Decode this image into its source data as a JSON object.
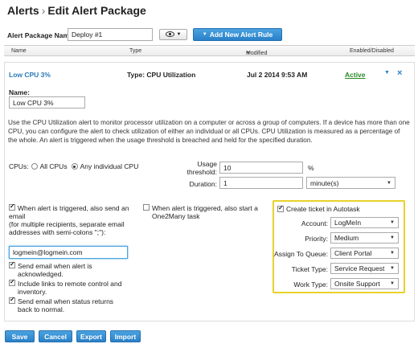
{
  "header": {
    "crumb": "Alerts",
    "separator": "›",
    "title": "Edit Alert Package"
  },
  "package": {
    "name_label": "Alert Package Name",
    "name_value": "Deploy #1",
    "add_rule_label": "Add New Alert Rule"
  },
  "columns": {
    "name": "Name",
    "type": "Type",
    "modified": "Modified",
    "sort_icon": "▼",
    "enabled": "Enabled/Disabled"
  },
  "rule": {
    "name": "Low CPU 3%",
    "type": "Type: CPU Utilization",
    "modified": "Jul 2 2014 9:53 AM",
    "status": "Active",
    "name_label": "Name:",
    "name_value": "Low CPU 3%",
    "description": "Use the CPU Utilization alert to monitor processor utilization on a computer or across a group of computers. If a device has more than one CPU, you can configure the alert to check utilization of either an individual or all CPUs. CPU Utilization is measured as a percentage of the whole. An alert is triggered when the usage threshold is breached and held for the specified duration."
  },
  "cpus": {
    "label": "CPUs:",
    "all_label": "All CPUs",
    "individual_label": "Any individual CPU",
    "selected": "individual"
  },
  "threshold": {
    "usage_label": "Usage threshold:",
    "usage_value": "10",
    "usage_unit": "%",
    "duration_label": "Duration:",
    "duration_value": "1",
    "duration_unit": "minute(s)"
  },
  "email": {
    "send_label": "When alert is triggered, also send an email",
    "send_hint": "(for multiple recipients, separate email addresses with semi-colons \";\"):",
    "address": "logmein@logmein.com",
    "ack_label": "Send email when alert is acknowledged.",
    "links_label": "Include links to remote control and inventory.",
    "normal_label": "Send email when status returns back to normal.",
    "checked": true
  },
  "one2many": {
    "label": "When alert is triggered, also start a One2Many task",
    "checked": false
  },
  "ticket": {
    "create_label": "Create ticket in Autotask",
    "checked": true,
    "fields": [
      {
        "label": "Account:",
        "value": "LogMeIn"
      },
      {
        "label": "Priority:",
        "value": "Medium"
      },
      {
        "label": "Assign To Queue:",
        "value": "Client Portal"
      },
      {
        "label": "Ticket Type:",
        "value": "Service Request"
      },
      {
        "label": "Work Type:",
        "value": "Onsite Support"
      }
    ]
  },
  "buttons": {
    "save": "Save",
    "cancel": "Cancel",
    "export": "Export",
    "import": "Import"
  },
  "colors": {
    "accent": "#2a80c8",
    "active": "#2a8a2a",
    "highlight": "#e8d12a"
  }
}
